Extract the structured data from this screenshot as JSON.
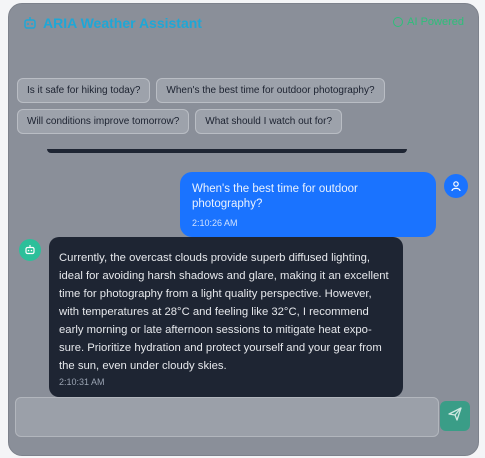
{
  "header": {
    "title": "ARIA Weather Assistant",
    "status": "AI Powered",
    "brand_icon": "robot-icon",
    "status_icon": "status-dot-icon"
  },
  "quick_replies": [
    [
      "Is it safe for hiking today?",
      "When's the best time for outdoor photography?"
    ],
    [
      "Will conditions improve tomorrow?",
      "What should I watch out for?"
    ]
  ],
  "messages": {
    "user": {
      "text": "When's the best time for outdoor photography?",
      "time": "2:10:26 AM",
      "avatar_icon": "user-icon"
    },
    "bot": {
      "text": "Currently, the overcast clouds provide superb diffused lighting, ideal for avoiding harsh shadows and glare, making it an excellent time for photography from a light quality perspective. However, with temperatures at 28°C and feeling like 32°C, I recommend early morning or late afternoon sessions to mitigate heat expo-sure. Prioritize hydration and protect yourself and your gear from the sun, even under cloudy skies.",
      "time": "2:10:31 AM",
      "avatar_icon": "robot-icon"
    }
  },
  "input": {
    "placeholder": "",
    "value": ""
  },
  "send_icon": "send-icon",
  "colors": {
    "panel": "#8a8f99",
    "accent_blue": "#1a73ff",
    "accent_green": "#2dbf7a",
    "bot_bubble": "#1e2533"
  }
}
